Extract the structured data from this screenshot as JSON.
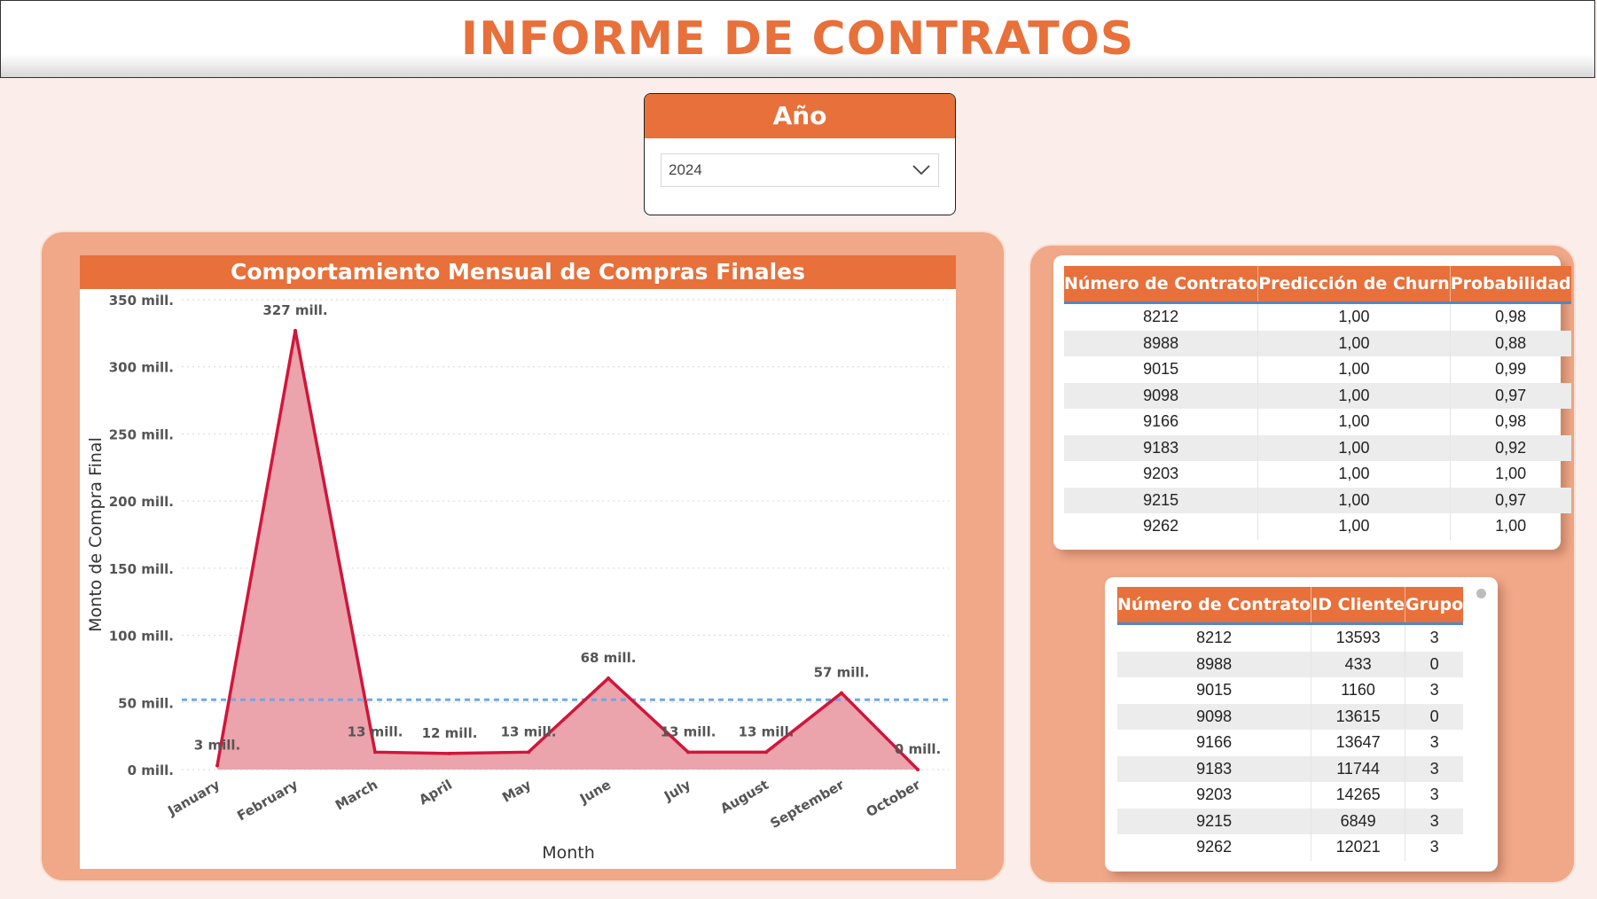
{
  "header": {
    "title": "INFORME DE CONTRATOS"
  },
  "slicer": {
    "title": "Año",
    "selected": "2024"
  },
  "chart": {
    "panel_title": "Comportamiento Mensual de Compras Finales"
  },
  "chart_data": {
    "type": "area",
    "title": "Comportamiento Mensual de Compras Finales",
    "xlabel": "Month",
    "ylabel": "Monto de Compra Final",
    "categories": [
      "January",
      "February",
      "March",
      "April",
      "May",
      "June",
      "July",
      "August",
      "September",
      "October"
    ],
    "values": [
      3,
      327,
      13,
      12,
      13,
      68,
      13,
      13,
      57,
      0
    ],
    "data_labels": [
      "3 mill.",
      "327 mill.",
      "13 mill.",
      "12 mill.",
      "13 mill.",
      "68 mill.",
      "13 mill.",
      "13 mill.",
      "57 mill.",
      "0 mill."
    ],
    "y_ticks": [
      "0 mill.",
      "50 mill.",
      "100 mill.",
      "150 mill.",
      "200 mill.",
      "250 mill.",
      "300 mill.",
      "350 mill."
    ],
    "ylim": [
      0,
      350
    ],
    "average_line": 52,
    "grid": true,
    "colors": {
      "line": "#d0163a",
      "fill": "#eba3ac",
      "average": "#6fa8e6"
    }
  },
  "table_churn": {
    "columns": [
      "Número de Contrato",
      "Predicción de Churn",
      "Probabilidad"
    ],
    "rows": [
      [
        "8212",
        "1,00",
        "0,98"
      ],
      [
        "8988",
        "1,00",
        "0,88"
      ],
      [
        "9015",
        "1,00",
        "0,99"
      ],
      [
        "9098",
        "1,00",
        "0,97"
      ],
      [
        "9166",
        "1,00",
        "0,98"
      ],
      [
        "9183",
        "1,00",
        "0,92"
      ],
      [
        "9203",
        "1,00",
        "1,00"
      ],
      [
        "9215",
        "1,00",
        "0,97"
      ],
      [
        "9262",
        "1,00",
        "1,00"
      ]
    ]
  },
  "table_grupos": {
    "columns": [
      "Número de Contrato",
      "ID Cliente",
      "Grupo"
    ],
    "rows": [
      [
        "8212",
        "13593",
        "3"
      ],
      [
        "8988",
        "433",
        "0"
      ],
      [
        "9015",
        "1160",
        "3"
      ],
      [
        "9098",
        "13615",
        "0"
      ],
      [
        "9166",
        "13647",
        "3"
      ],
      [
        "9183",
        "11744",
        "3"
      ],
      [
        "9203",
        "14265",
        "3"
      ],
      [
        "9215",
        "6849",
        "3"
      ],
      [
        "9262",
        "12021",
        "3"
      ]
    ]
  },
  "colors": {
    "accent": "#e8703a",
    "panel": "#f0a888",
    "background": "#fbeeea"
  }
}
